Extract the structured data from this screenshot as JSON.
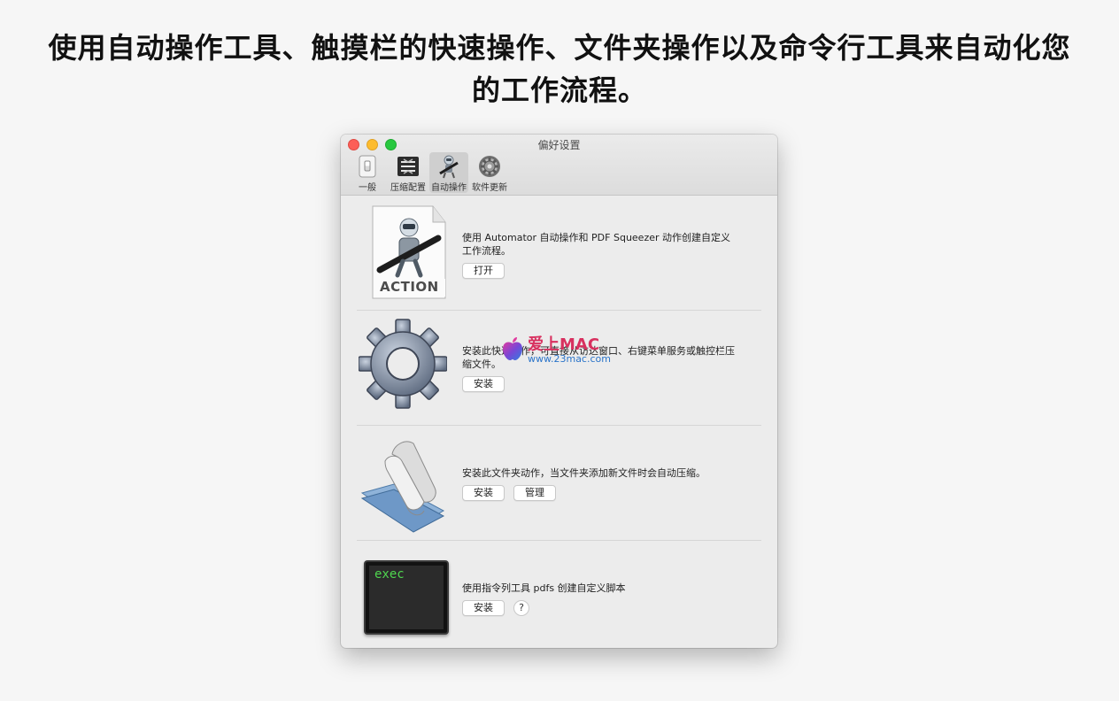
{
  "headline": {
    "line1": "使用自动操作工具、触摸栏的快速操作、文件夹操作以及命令行工具来自动化您",
    "line2": "的工作流程。"
  },
  "window": {
    "title": "偏好设置",
    "toolbar": [
      {
        "label": "一般",
        "icon": "switch-icon"
      },
      {
        "label": "压缩配置",
        "icon": "compress-icon"
      },
      {
        "label": "自动操作",
        "icon": "automator-icon",
        "active": true
      },
      {
        "label": "软件更新",
        "icon": "gear-icon"
      }
    ]
  },
  "rows": [
    {
      "icon_label": "ACTION",
      "text_line1": "使用 Automator 自动操作和 PDF Squeezer 动作创建自定义",
      "text_line2": "工作流程。",
      "button1": "打开"
    },
    {
      "text_line1": "安装此快速操作，可直接从访达窗口、右键菜单服务或触控栏压",
      "text_line2": "缩文件。",
      "button1": "安装"
    },
    {
      "text_line1": "安装此文件夹动作，当文件夹添加新文件时会自动压缩。",
      "button1": "安装",
      "button2": "管理"
    },
    {
      "icon_label": "exec",
      "text_line1": "使用指令列工具 pdfs 创建自定义脚本",
      "button1": "安装",
      "help": "?"
    }
  ],
  "watermark": {
    "main": "爱上MAC",
    "sub": "www.23mac.com"
  },
  "colors": {
    "close": "#fc5f57",
    "minimize": "#fdbc2e",
    "maximize": "#28c83f",
    "terminal_text": "#4fd64f",
    "watermark_red": "#d8305f",
    "watermark_blue": "#2a74c9"
  }
}
